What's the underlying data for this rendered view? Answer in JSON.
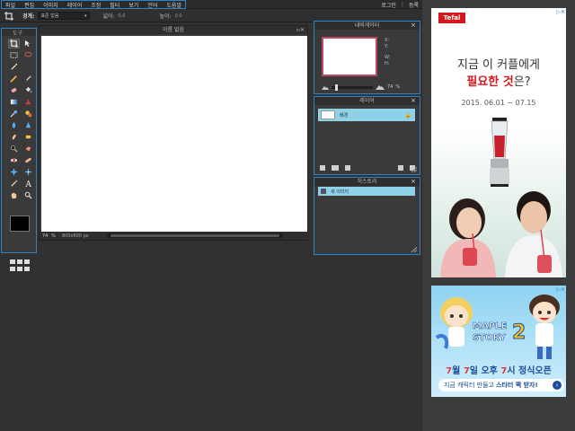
{
  "menubar": {
    "items": [
      "파일",
      "편집",
      "이미지",
      "레이어",
      "조정",
      "필터",
      "보기",
      "언어",
      "도움말"
    ],
    "login": "로그인",
    "separator": "|",
    "register": "등록"
  },
  "options": {
    "feather_label": "경계:",
    "feather_value": "표준 없음",
    "width_label": "넓이:",
    "width_value": "0.0",
    "height_label": "높이:",
    "height_value": "0.0"
  },
  "toolbox": {
    "title": "도구"
  },
  "canvas": {
    "title": "이름 없음",
    "zoom": "74",
    "pct": "%",
    "size": "800x600 px"
  },
  "navigator": {
    "title": "내비게이터",
    "x_label": "X:",
    "y_label": "Y:",
    "w_label": "W:",
    "h_label": "H:",
    "zoom": "74",
    "pct": "%",
    "zoom_level": 0.74
  },
  "layers": {
    "title": "레이어",
    "layer_name": "배경"
  },
  "history": {
    "title": "히스토리",
    "item": "새 이미지"
  },
  "ad1": {
    "brand": "Tefal",
    "line1": "지금 이 커플에게",
    "line2_highlight": "필요한 것",
    "line2_rest": "은?",
    "date": "2015. 06.01 ~ 07.15"
  },
  "ad2": {
    "logo_line1": "MAPLE",
    "logo_line2": "STORY",
    "logo_number": "2",
    "date_a": "7",
    "date_b": "월 ",
    "date_c": "7",
    "date_d": "일 오후 ",
    "date_e": "7",
    "date_f": "시 정식오픈",
    "cta_prefix": "지금 캐릭터 만들고",
    "cta_bold": "스타터 팩 받자!",
    "cta_arrow": "›"
  },
  "colors": {
    "accent_border": "#2d83c7",
    "selected_row": "#8fd1e6",
    "brand_red": "#d4191d"
  }
}
